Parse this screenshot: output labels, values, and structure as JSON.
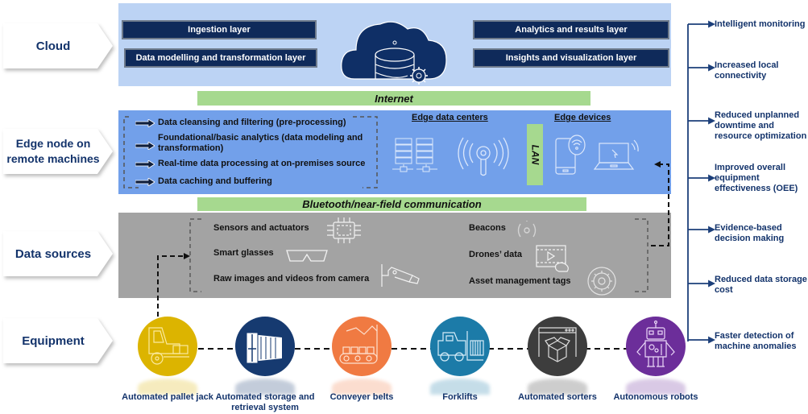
{
  "rows": {
    "cloud": "Cloud",
    "edge": "Edge node on remote machines",
    "data_sources": "Data sources",
    "equipment": "Equipment"
  },
  "cloud": {
    "layers_left": [
      "Ingestion layer",
      "Data modelling and transformation layer"
    ],
    "layers_right": [
      "Analytics and results layer",
      "Insights and visualization layer"
    ],
    "icon": "cloud-database-gear-icon"
  },
  "connectors": {
    "internet": "Internet",
    "bluetooth": "Bluetooth/near-field communication",
    "lan": "LAN"
  },
  "edge": {
    "processes": [
      "Data cleansing and filtering (pre-processing)",
      "Foundational/basic analytics (data modeling and transformation)",
      "Real-time data processing at on-premises source",
      "Data caching and buffering"
    ],
    "data_centers_title": "Edge data centers",
    "devices_title": "Edge devices"
  },
  "data_sources": {
    "left": [
      "Sensors and actuators",
      "Smart glasses",
      "Raw images and videos from camera"
    ],
    "right": [
      "Beacons",
      "Drones’ data",
      "Asset management tags"
    ]
  },
  "equipment": [
    {
      "label": "Automated pallet jack",
      "color": "#dcb400"
    },
    {
      "label": "Automated storage and retrieval system",
      "color": "#163a70"
    },
    {
      "label": "Conveyer belts",
      "color": "#f07a42"
    },
    {
      "label": "Forklifts",
      "color": "#1c7ba8"
    },
    {
      "label": "Automated sorters",
      "color": "#3d3d3d"
    },
    {
      "label": "Autonomous robots",
      "color": "#6c2e9a"
    }
  ],
  "benefits": [
    "Intelligent monitoring",
    "Increased local connectivity",
    "Reduced unplanned downtime and resource optimization",
    "Improved overall equipment effectiveness (OEE)",
    "Evidence-based decision making",
    "Reduced data storage cost",
    "Faster detection of machine anomalies"
  ],
  "colors": {
    "navy": "#13336b",
    "cloud_band": "#bcd3f4",
    "edge_band": "#72a0ea",
    "source_band": "#a3a3a3",
    "connector_green": "#a6d98f"
  }
}
